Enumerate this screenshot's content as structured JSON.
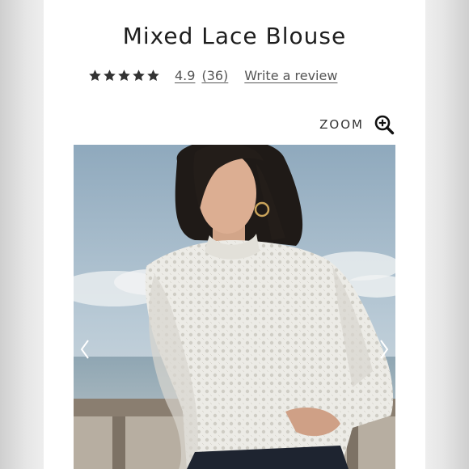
{
  "product": {
    "title": "Mixed Lace Blouse",
    "rating": "4.9",
    "rating_stars": 5,
    "review_count": "(36)",
    "write_review": "Write a review"
  },
  "zoom": {
    "label": "ZOOM",
    "icon": "zoom-in-icon"
  },
  "gallery": {
    "prev_icon": "chevron-left-icon",
    "next_icon": "chevron-right-icon"
  },
  "colors": {
    "text": "#1e1e1e",
    "link": "#555555",
    "star": "#333333"
  }
}
